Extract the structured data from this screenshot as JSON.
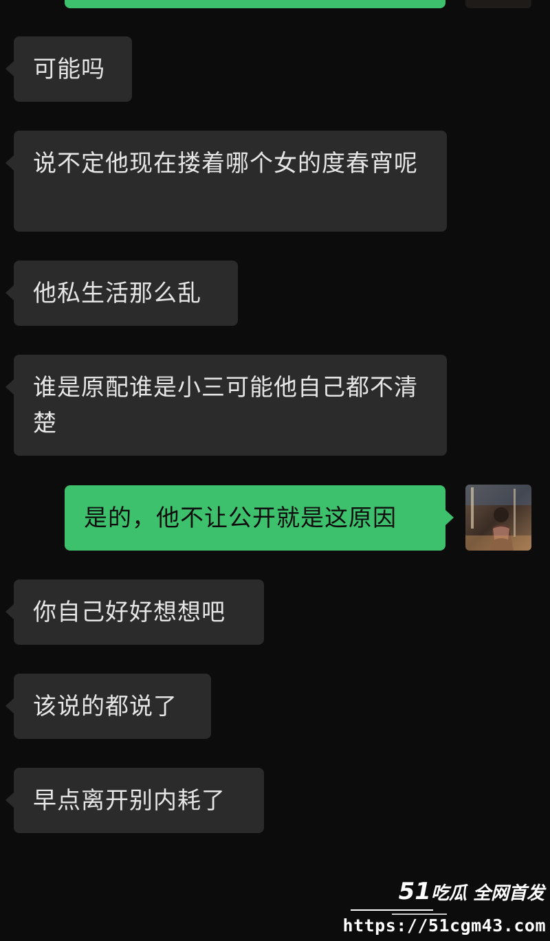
{
  "chat": {
    "messages": [
      {
        "side": "in",
        "text": "可能吗"
      },
      {
        "side": "in",
        "text": "说不定他现在搂着哪个女的度春宵呢"
      },
      {
        "side": "in",
        "text": "他私生活那么乱"
      },
      {
        "side": "in",
        "text": "谁是原配谁是小三可能他自己都不清楚"
      },
      {
        "side": "out",
        "text": "是的，他不让公开就是这原因"
      },
      {
        "side": "in",
        "text": "你自己好好想想吧"
      },
      {
        "side": "in",
        "text": "该说的都说了"
      },
      {
        "side": "in",
        "text": "早点离开别内耗了"
      }
    ],
    "colors": {
      "background": "#0c0c0c",
      "incoming_bubble": "#2b2b2b",
      "outgoing_bubble": "#3ec16d"
    }
  },
  "watermark": {
    "brand_num": "51",
    "brand_text": "吃瓜 全网首发",
    "url": "https://51cgm43.com"
  }
}
